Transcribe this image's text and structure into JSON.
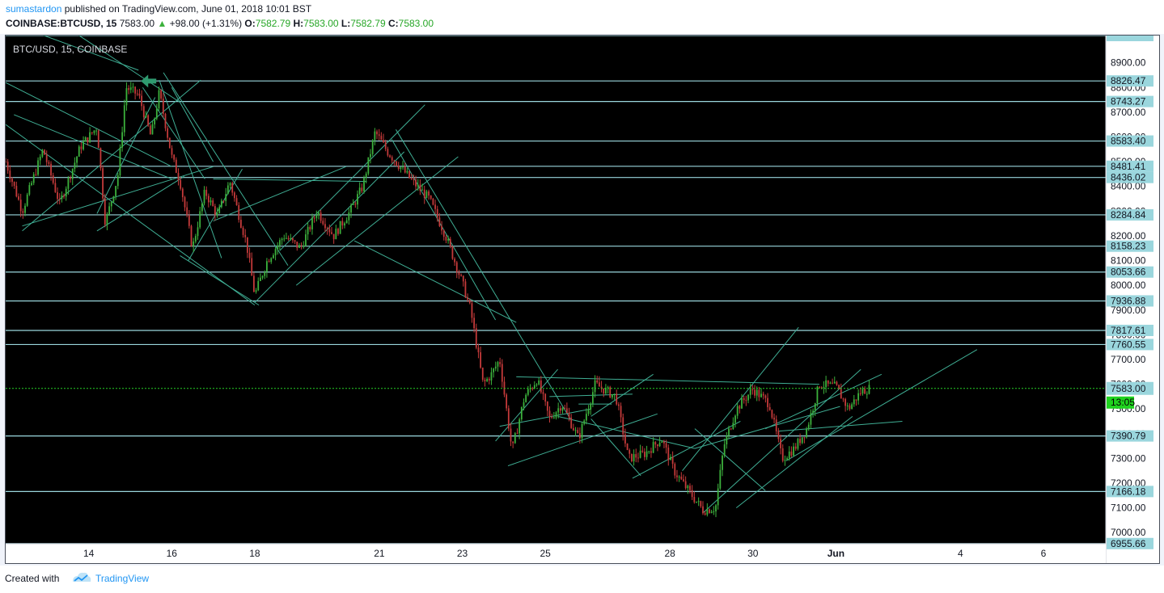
{
  "header": {
    "author": "sumastardon",
    "published_text": "published on TradingView.com, June 01, 2018 10:01 BST",
    "symbol": "COINBASE:BTCUSD, 15",
    "price": "7583.00",
    "change": "+98.00 (+1.31%)",
    "o_label": "O:",
    "o_value": "7582.79",
    "h_label": "H:",
    "h_value": "7583.00",
    "l_label": "L:",
    "l_value": "7582.79",
    "c_label": "C:",
    "c_value": "7583.00"
  },
  "chart_label": "BTC/USD, 15, COINBASE",
  "footer": {
    "created_with": "Created with",
    "brand": "TradingView"
  },
  "colors": {
    "background": "#000000",
    "hline": "#9ad6dd",
    "trend": "#3fae94",
    "up": "#3cb13c",
    "down": "#c43a3a",
    "last": "#26d126",
    "price_tag": "#9ad6dd"
  },
  "chart_data": {
    "type": "candlestick",
    "title": "BTC/USD, 15, COINBASE",
    "x_ticks": [
      {
        "label": "14",
        "day": 14
      },
      {
        "label": "16",
        "day": 16
      },
      {
        "label": "18",
        "day": 18
      },
      {
        "label": "21",
        "day": 21
      },
      {
        "label": "23",
        "day": 23
      },
      {
        "label": "25",
        "day": 25
      },
      {
        "label": "28",
        "day": 28
      },
      {
        "label": "30",
        "day": 30
      },
      {
        "label": "Jun",
        "day": 32
      },
      {
        "label": "4",
        "day": 35
      },
      {
        "label": "6",
        "day": 37
      }
    ],
    "y_ticks": [
      7000,
      7100,
      7200,
      7300,
      7400,
      7500,
      7600,
      7700,
      7800,
      7900,
      8000,
      8100,
      8200,
      8300,
      8400,
      8500,
      8600,
      8700,
      8800,
      8900
    ],
    "y_tick_labels": [
      "7000.00",
      "7100.00",
      "7200.00",
      "7300.00",
      "7400.00",
      "7500.00",
      "7600.00",
      "7700.00",
      "7800.00",
      "7900.00",
      "8000.00",
      "8100.00",
      "8200.00",
      "8300.00",
      "8400.00",
      "8500.00",
      "8600.00",
      "8700.00",
      "8800.00",
      "8900.00"
    ],
    "ylim": [
      6955,
      9010
    ],
    "xlim": [
      12.0,
      38.5
    ],
    "horizontal_levels": [
      {
        "value": 9010,
        "label": ""
      },
      {
        "value": 8826.47,
        "label": "8826.47"
      },
      {
        "value": 8743.27,
        "label": "8743.27"
      },
      {
        "value": 8583.4,
        "label": "8583.40"
      },
      {
        "value": 8481.41,
        "label": "8481.41"
      },
      {
        "value": 8436.02,
        "label": "8436.02"
      },
      {
        "value": 8284.84,
        "label": "8284.84"
      },
      {
        "value": 8158.23,
        "label": "8158.23"
      },
      {
        "value": 8053.66,
        "label": "8053.66"
      },
      {
        "value": 7936.88,
        "label": "7936.88"
      },
      {
        "value": 7817.61,
        "label": "7817.61"
      },
      {
        "value": 7760.55,
        "label": "7760.55"
      },
      {
        "value": 7390.79,
        "label": "7390.79"
      },
      {
        "value": 7166.18,
        "label": "7166.18"
      },
      {
        "value": 6955.66,
        "label": "6955.66"
      }
    ],
    "last_price": {
      "value": 7583.0,
      "label": "7583.00",
      "countdown": "13:05"
    },
    "price_path": [
      [
        12.0,
        8500
      ],
      [
        12.4,
        8300
      ],
      [
        12.9,
        8550
      ],
      [
        13.3,
        8330
      ],
      [
        13.8,
        8560
      ],
      [
        14.2,
        8640
      ],
      [
        14.4,
        8250
      ],
      [
        14.7,
        8440
      ],
      [
        14.9,
        8800
      ],
      [
        15.2,
        8770
      ],
      [
        15.5,
        8600
      ],
      [
        15.7,
        8780
      ],
      [
        16.0,
        8520
      ],
      [
        16.2,
        8420
      ],
      [
        16.5,
        8150
      ],
      [
        16.8,
        8380
      ],
      [
        17.1,
        8280
      ],
      [
        17.4,
        8420
      ],
      [
        17.8,
        8170
      ],
      [
        18.0,
        7960
      ],
      [
        18.3,
        8100
      ],
      [
        18.7,
        8200
      ],
      [
        19.1,
        8150
      ],
      [
        19.5,
        8300
      ],
      [
        19.9,
        8200
      ],
      [
        20.3,
        8300
      ],
      [
        20.6,
        8400
      ],
      [
        20.9,
        8620
      ],
      [
        21.2,
        8540
      ],
      [
        21.5,
        8480
      ],
      [
        21.8,
        8420
      ],
      [
        22.2,
        8350
      ],
      [
        22.6,
        8200
      ],
      [
        23.0,
        8010
      ],
      [
        23.2,
        7900
      ],
      [
        23.5,
        7600
      ],
      [
        23.7,
        7640
      ],
      [
        23.9,
        7700
      ],
      [
        24.2,
        7330
      ],
      [
        24.5,
        7550
      ],
      [
        24.8,
        7620
      ],
      [
        25.1,
        7460
      ],
      [
        25.4,
        7520
      ],
      [
        25.8,
        7380
      ],
      [
        26.2,
        7600
      ],
      [
        26.7,
        7550
      ],
      [
        27.0,
        7300
      ],
      [
        27.4,
        7320
      ],
      [
        27.8,
        7380
      ],
      [
        28.1,
        7250
      ],
      [
        28.4,
        7180
      ],
      [
        28.8,
        7090
      ],
      [
        29.1,
        7100
      ],
      [
        29.3,
        7350
      ],
      [
        29.6,
        7500
      ],
      [
        30.0,
        7580
      ],
      [
        30.4,
        7520
      ],
      [
        30.7,
        7300
      ],
      [
        31.0,
        7340
      ],
      [
        31.3,
        7420
      ],
      [
        31.6,
        7600
      ],
      [
        32.0,
        7590
      ],
      [
        32.3,
        7500
      ],
      [
        32.6,
        7570
      ],
      [
        32.8,
        7583
      ]
    ],
    "trend_lines": [
      [
        12.0,
        8650,
        18.0,
        7920
      ],
      [
        12.0,
        8820,
        16.0,
        8480
      ],
      [
        12.4,
        8240,
        17.0,
        8480
      ],
      [
        12.2,
        8690,
        16.0,
        8430
      ],
      [
        12.4,
        8220,
        16.7,
        8830
      ],
      [
        12.6,
        9030,
        15.2,
        8870
      ],
      [
        13.5,
        9040,
        16.2,
        8740
      ],
      [
        14.2,
        8290,
        15.6,
        8760
      ],
      [
        14.2,
        8220,
        16.3,
        8440
      ],
      [
        15.3,
        8800,
        16.8,
        8430
      ],
      [
        15.7,
        8830,
        17.2,
        8110
      ],
      [
        16.0,
        8800,
        17.0,
        8500
      ],
      [
        16.2,
        8120,
        18.1,
        7920
      ],
      [
        16.4,
        8100,
        17.7,
        8470
      ],
      [
        15.8,
        8860,
        18.8,
        8080
      ],
      [
        17.0,
        8260,
        20.2,
        8480
      ],
      [
        17.0,
        8430,
        20.7,
        8420
      ],
      [
        18.0,
        7930,
        21.6,
        8540
      ],
      [
        18.6,
        8140,
        22.1,
        8730
      ],
      [
        19.0,
        8000,
        22.9,
        8520
      ],
      [
        20.4,
        8180,
        24.3,
        7850
      ],
      [
        21.3,
        8590,
        23.8,
        7860
      ],
      [
        21.4,
        8630,
        25.6,
        7460
      ],
      [
        23.9,
        7430,
        26.1,
        7500
      ],
      [
        23.8,
        7370,
        25.3,
        7660
      ],
      [
        24.1,
        7270,
        27.7,
        7480
      ],
      [
        24.3,
        7630,
        31.6,
        7600
      ],
      [
        25.1,
        7550,
        27.1,
        7560
      ],
      [
        25.3,
        7470,
        28.6,
        7340
      ],
      [
        25.8,
        7520,
        26.6,
        7520
      ],
      [
        26.1,
        7470,
        27.6,
        7640
      ],
      [
        26.1,
        7460,
        27.3,
        7230
      ],
      [
        27.1,
        7220,
        29.7,
        7450
      ],
      [
        28.6,
        7420,
        30.3,
        7170
      ],
      [
        28.6,
        7340,
        32.1,
        7510
      ],
      [
        28.3,
        7250,
        31.1,
        7830
      ],
      [
        28.8,
        7080,
        32.6,
        7660
      ],
      [
        29.6,
        7100,
        32.4,
        7470
      ],
      [
        30.3,
        7420,
        33.1,
        7640
      ],
      [
        30.6,
        7410,
        33.6,
        7450
      ],
      [
        30.8,
        7290,
        35.4,
        7740
      ]
    ]
  }
}
